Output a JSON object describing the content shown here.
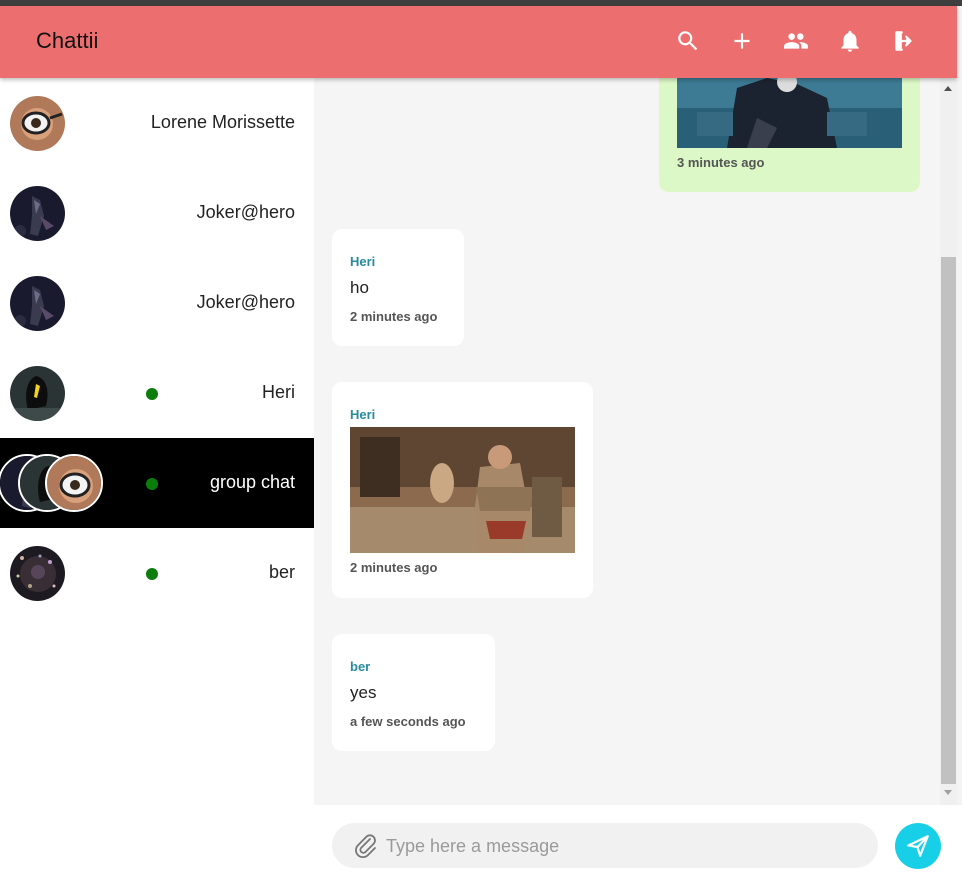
{
  "app": {
    "title": "Chattii"
  },
  "header": {
    "icons": [
      "search-icon",
      "add-icon",
      "group-icon",
      "bell-icon",
      "logout-icon"
    ]
  },
  "contacts": [
    {
      "name": "Lorene Morissette",
      "online": false
    },
    {
      "name": "Joker@hero",
      "online": false
    },
    {
      "name": "Joker@hero",
      "online": false
    },
    {
      "name": "Heri",
      "online": true
    },
    {
      "name": "group chat",
      "online": true,
      "active": true
    },
    {
      "name": "ber",
      "online": true
    }
  ],
  "messages": [
    {
      "sender": "",
      "type": "image",
      "time": "3 minutes ago",
      "mine": true
    },
    {
      "sender": "Heri",
      "type": "text",
      "text": "ho",
      "time": "2 minutes ago"
    },
    {
      "sender": "Heri",
      "type": "image",
      "time": "2 minutes ago"
    },
    {
      "sender": "ber",
      "type": "text",
      "text": "yes",
      "time": "a few seconds ago"
    }
  ],
  "composer": {
    "placeholder": "Type here a message"
  },
  "colors": {
    "appbar": "#ec6e6e",
    "online": "#0a7d0a",
    "send": "#17d0e8",
    "mine_bubble": "#dcf8c6",
    "sender": "#2a8ba0"
  }
}
